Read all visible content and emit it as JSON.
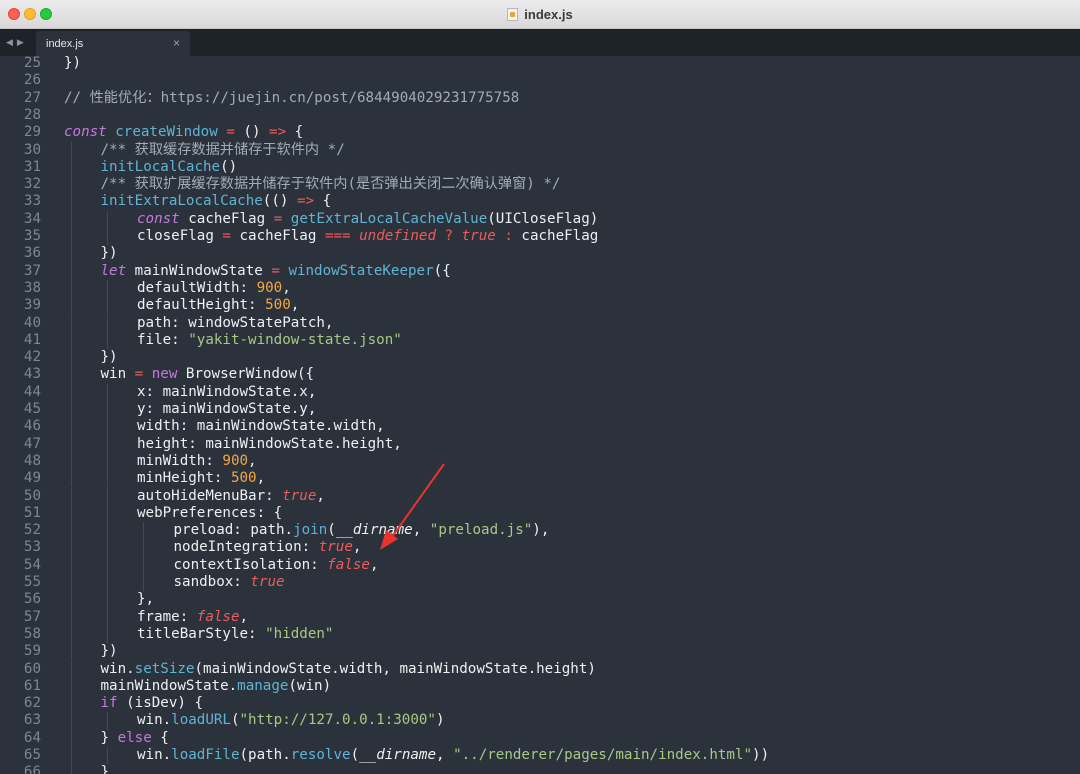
{
  "window": {
    "title": "index.js"
  },
  "tabs": [
    {
      "label": "index.js",
      "close": "×"
    }
  ],
  "nav": {
    "back": "◀",
    "forward": "▶"
  },
  "colors": {
    "keyword": "#c678dd",
    "function": "#5fb4d4",
    "number": "#f5a742",
    "string": "#a8c983",
    "comment": "#a3abb5",
    "boolean": "#ef5b5b",
    "operator": "#e55c5c",
    "text": "#eef0f2",
    "annotation_arrow": "#e8342c"
  },
  "editor": {
    "lines": [
      {
        "n": "25",
        "indent": 0,
        "tokens": [
          [
            "p",
            "})"
          ]
        ]
      },
      {
        "n": "26",
        "indent": 0,
        "tokens": []
      },
      {
        "n": "27",
        "indent": 0,
        "tokens": [
          [
            "com",
            "// 性能优化：https://juejin.cn/post/6844904029231775758"
          ]
        ]
      },
      {
        "n": "28",
        "indent": 0,
        "tokens": []
      },
      {
        "n": "29",
        "indent": 0,
        "tokens": [
          [
            "kw",
            "const"
          ],
          [
            "p",
            " "
          ],
          [
            "fn",
            "createWindow"
          ],
          [
            "p",
            " "
          ],
          [
            "op",
            "="
          ],
          [
            "p",
            " () "
          ],
          [
            "op",
            "=>"
          ],
          [
            "p",
            " {"
          ]
        ]
      },
      {
        "n": "30",
        "indent": 1,
        "tokens": [
          [
            "com",
            "/** 获取缓存数据并储存于软件内 */"
          ]
        ]
      },
      {
        "n": "31",
        "indent": 1,
        "tokens": [
          [
            "fn",
            "initLocalCache"
          ],
          [
            "p",
            "()"
          ]
        ]
      },
      {
        "n": "32",
        "indent": 1,
        "tokens": [
          [
            "com",
            "/** 获取扩展缓存数据并储存于软件内(是否弹出关闭二次确认弹窗) */"
          ]
        ]
      },
      {
        "n": "33",
        "indent": 1,
        "tokens": [
          [
            "fn",
            "initExtraLocalCache"
          ],
          [
            "p",
            "(() "
          ],
          [
            "op",
            "=>"
          ],
          [
            "p",
            " {"
          ]
        ]
      },
      {
        "n": "34",
        "indent": 2,
        "tokens": [
          [
            "kw",
            "const"
          ],
          [
            "p",
            " cacheFlag "
          ],
          [
            "op",
            "="
          ],
          [
            "p",
            " "
          ],
          [
            "fn",
            "getExtraLocalCacheValue"
          ],
          [
            "p",
            "(UICloseFlag)"
          ]
        ]
      },
      {
        "n": "35",
        "indent": 2,
        "tokens": [
          [
            "p",
            "closeFlag "
          ],
          [
            "op",
            "="
          ],
          [
            "p",
            " cacheFlag "
          ],
          [
            "op",
            "==="
          ],
          [
            "p",
            " "
          ],
          [
            "bool",
            "undefined"
          ],
          [
            "p",
            " "
          ],
          [
            "op",
            "?"
          ],
          [
            "p",
            " "
          ],
          [
            "bool",
            "true"
          ],
          [
            "p",
            " "
          ],
          [
            "op",
            ":"
          ],
          [
            "p",
            " cacheFlag"
          ]
        ]
      },
      {
        "n": "36",
        "indent": 1,
        "tokens": [
          [
            "p",
            "})"
          ]
        ]
      },
      {
        "n": "37",
        "indent": 1,
        "tokens": [
          [
            "kw",
            "let"
          ],
          [
            "p",
            " mainWindowState "
          ],
          [
            "op",
            "="
          ],
          [
            "p",
            " "
          ],
          [
            "fn",
            "windowStateKeeper"
          ],
          [
            "p",
            "({"
          ]
        ]
      },
      {
        "n": "38",
        "indent": 2,
        "tokens": [
          [
            "p",
            "defaultWidth: "
          ],
          [
            "num",
            "900"
          ],
          [
            "p",
            ","
          ]
        ]
      },
      {
        "n": "39",
        "indent": 2,
        "tokens": [
          [
            "p",
            "defaultHeight: "
          ],
          [
            "num",
            "500"
          ],
          [
            "p",
            ","
          ]
        ]
      },
      {
        "n": "40",
        "indent": 2,
        "tokens": [
          [
            "p",
            "path: windowStatePatch,"
          ]
        ]
      },
      {
        "n": "41",
        "indent": 2,
        "tokens": [
          [
            "p",
            "file: "
          ],
          [
            "str",
            "\"yakit-window-state.json\""
          ]
        ]
      },
      {
        "n": "42",
        "indent": 1,
        "tokens": [
          [
            "p",
            "})"
          ]
        ]
      },
      {
        "n": "43",
        "indent": 1,
        "tokens": [
          [
            "p",
            "win "
          ],
          [
            "op",
            "="
          ],
          [
            "p",
            " "
          ],
          [
            "pk",
            "new"
          ],
          [
            "p",
            " BrowserWindow({"
          ]
        ]
      },
      {
        "n": "44",
        "indent": 2,
        "tokens": [
          [
            "p",
            "x: mainWindowState.x,"
          ]
        ]
      },
      {
        "n": "45",
        "indent": 2,
        "tokens": [
          [
            "p",
            "y: mainWindowState.y,"
          ]
        ]
      },
      {
        "n": "46",
        "indent": 2,
        "tokens": [
          [
            "p",
            "width: mainWindowState.width,"
          ]
        ]
      },
      {
        "n": "47",
        "indent": 2,
        "tokens": [
          [
            "p",
            "height: mainWindowState.height,"
          ]
        ]
      },
      {
        "n": "48",
        "indent": 2,
        "tokens": [
          [
            "p",
            "minWidth: "
          ],
          [
            "num",
            "900"
          ],
          [
            "p",
            ","
          ]
        ]
      },
      {
        "n": "49",
        "indent": 2,
        "tokens": [
          [
            "p",
            "minHeight: "
          ],
          [
            "num",
            "500"
          ],
          [
            "p",
            ","
          ]
        ]
      },
      {
        "n": "50",
        "indent": 2,
        "tokens": [
          [
            "p",
            "autoHideMenuBar: "
          ],
          [
            "bool",
            "true"
          ],
          [
            "p",
            ","
          ]
        ]
      },
      {
        "n": "51",
        "indent": 2,
        "tokens": [
          [
            "p",
            "webPreferences: {"
          ]
        ]
      },
      {
        "n": "52",
        "indent": 3,
        "tokens": [
          [
            "p",
            "preload: path."
          ],
          [
            "fn",
            "join"
          ],
          [
            "p",
            "("
          ],
          [
            "dir",
            "__dirname"
          ],
          [
            "p",
            ", "
          ],
          [
            "str",
            "\"preload.js\""
          ],
          [
            "p",
            "),"
          ]
        ]
      },
      {
        "n": "53",
        "indent": 3,
        "tokens": [
          [
            "p",
            "nodeIntegration: "
          ],
          [
            "bool",
            "true"
          ],
          [
            "p",
            ","
          ]
        ]
      },
      {
        "n": "54",
        "indent": 3,
        "tokens": [
          [
            "p",
            "contextIsolation: "
          ],
          [
            "bool",
            "false"
          ],
          [
            "p",
            ","
          ]
        ]
      },
      {
        "n": "55",
        "indent": 3,
        "tokens": [
          [
            "p",
            "sandbox: "
          ],
          [
            "bool",
            "true"
          ]
        ]
      },
      {
        "n": "56",
        "indent": 2,
        "tokens": [
          [
            "p",
            "},"
          ]
        ]
      },
      {
        "n": "57",
        "indent": 2,
        "tokens": [
          [
            "p",
            "frame: "
          ],
          [
            "bool",
            "false"
          ],
          [
            "p",
            ","
          ]
        ]
      },
      {
        "n": "58",
        "indent": 2,
        "tokens": [
          [
            "p",
            "titleBarStyle: "
          ],
          [
            "str",
            "\"hidden\""
          ]
        ]
      },
      {
        "n": "59",
        "indent": 1,
        "tokens": [
          [
            "p",
            "})"
          ]
        ]
      },
      {
        "n": "60",
        "indent": 1,
        "tokens": [
          [
            "p",
            "win."
          ],
          [
            "fn",
            "setSize"
          ],
          [
            "p",
            "(mainWindowState.width, mainWindowState.height)"
          ]
        ]
      },
      {
        "n": "61",
        "indent": 1,
        "tokens": [
          [
            "p",
            "mainWindowState."
          ],
          [
            "fn",
            "manage"
          ],
          [
            "p",
            "(win)"
          ]
        ]
      },
      {
        "n": "62",
        "indent": 1,
        "tokens": [
          [
            "pk",
            "if"
          ],
          [
            "p",
            " (isDev) {"
          ]
        ]
      },
      {
        "n": "63",
        "indent": 2,
        "tokens": [
          [
            "p",
            "win."
          ],
          [
            "fn",
            "loadURL"
          ],
          [
            "p",
            "("
          ],
          [
            "str",
            "\"http://127.0.0.1:3000\""
          ],
          [
            "p",
            ")"
          ]
        ]
      },
      {
        "n": "64",
        "indent": 1,
        "tokens": [
          [
            "p",
            "} "
          ],
          [
            "pk",
            "else"
          ],
          [
            "p",
            " {"
          ]
        ]
      },
      {
        "n": "65",
        "indent": 2,
        "tokens": [
          [
            "p",
            "win."
          ],
          [
            "fn",
            "loadFile"
          ],
          [
            "p",
            "(path."
          ],
          [
            "fn",
            "resolve"
          ],
          [
            "p",
            "("
          ],
          [
            "dir",
            "__dirname"
          ],
          [
            "p",
            ", "
          ],
          [
            "str",
            "\"../renderer/pages/main/index.html\""
          ],
          [
            "p",
            "))"
          ]
        ]
      },
      {
        "n": "66",
        "indent": 1,
        "tokens": [
          [
            "p",
            "}"
          ]
        ]
      }
    ]
  }
}
